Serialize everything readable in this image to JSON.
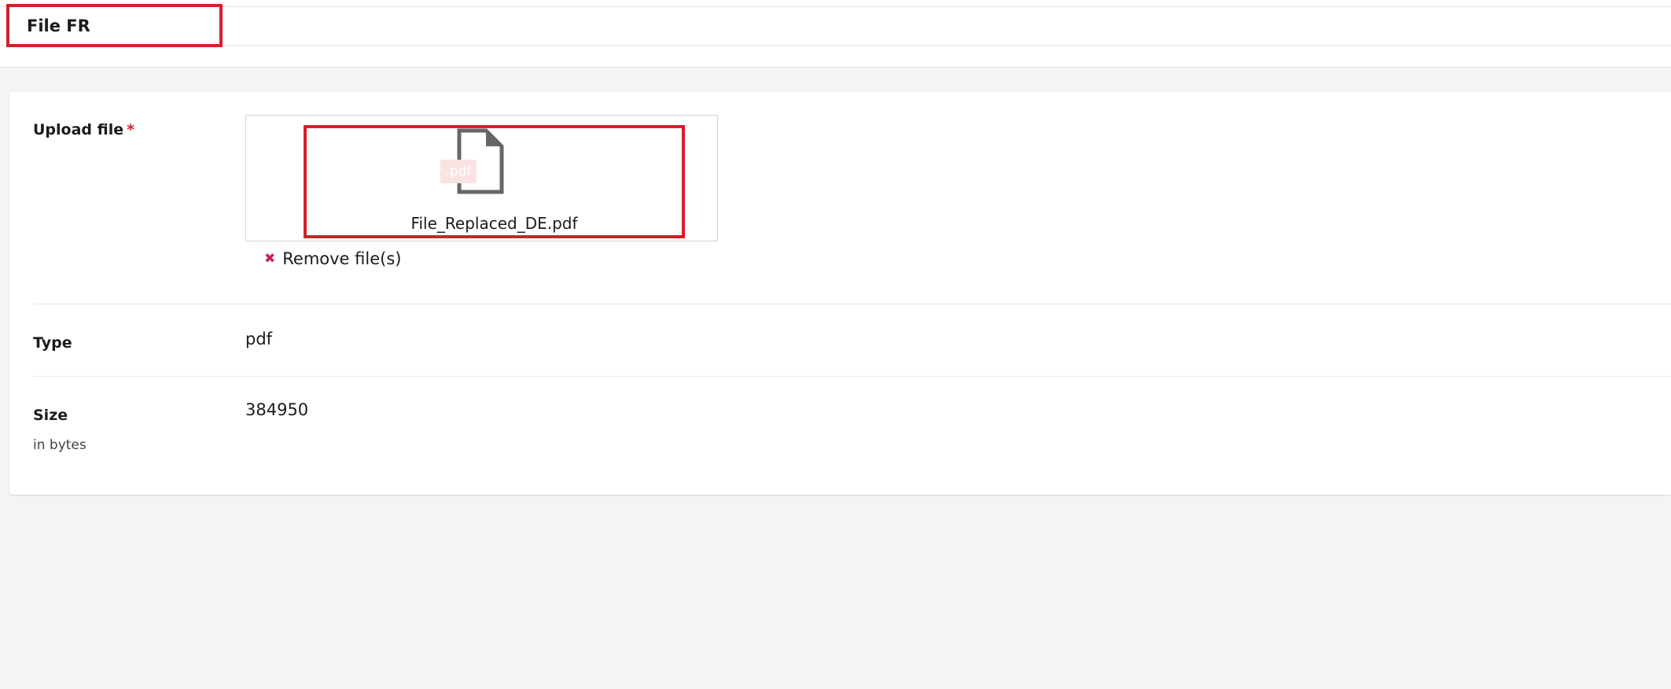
{
  "tab": {
    "label": "File FR"
  },
  "form": {
    "upload": {
      "label": "Upload file",
      "required_mark": "*",
      "file_extension": ".pdf",
      "file_name": "File_Replaced_DE.pdf",
      "remove_label": "Remove file(s)",
      "remove_icon": "close-icon"
    },
    "type": {
      "label": "Type",
      "value": "pdf"
    },
    "size": {
      "label": "Size",
      "sublabel": "in bytes",
      "value": "384950"
    }
  },
  "colors": {
    "highlight": "#d3202c",
    "required": "#d3202c",
    "remove_icon": "#c8245a",
    "page_background": "#f5f3f3",
    "card_background": "#ffffff",
    "file_icon": "#666666"
  }
}
